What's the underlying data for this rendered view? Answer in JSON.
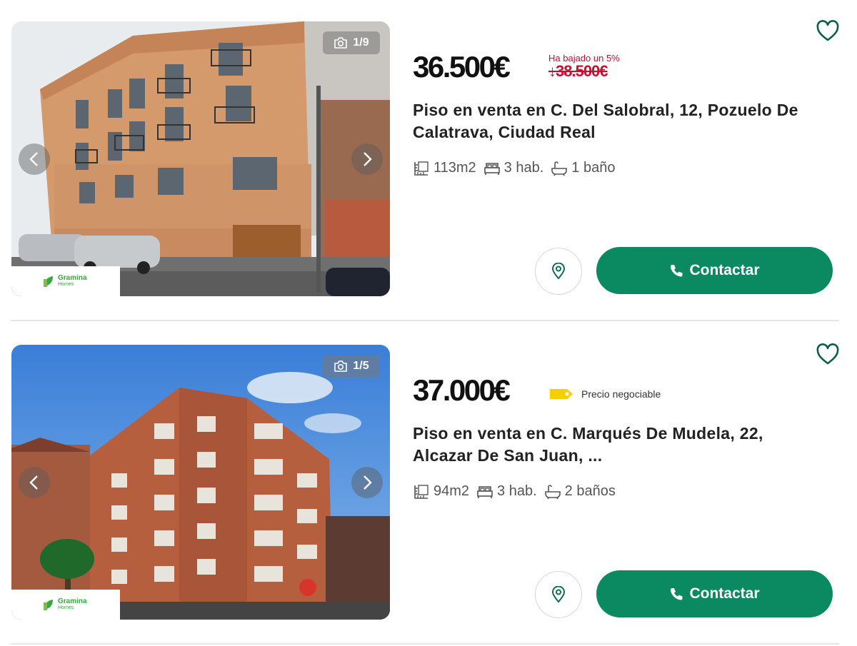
{
  "listings": [
    {
      "photo_counter": "1/9",
      "agency_logo": {
        "name": "Gramina",
        "sub": "Homes"
      },
      "price": "36.500€",
      "price_drop_note": "Ha bajado un 5%",
      "old_price": "↓38.500€",
      "title": "Piso en venta en C. Del Salobral, 12, Pozuelo De Calatrava, Ciudad Real",
      "features": {
        "area": "113m2",
        "rooms": "3 hab.",
        "baths": "1 baño"
      },
      "contact_label": "Contactar"
    },
    {
      "photo_counter": "1/5",
      "agency_logo": {
        "name": "Gramina",
        "sub": "Homes"
      },
      "price": "37.000€",
      "negotiable_label": "Precio negociable",
      "title": "Piso en venta en C. Marqués De Mudela, 22, Alcazar De San Juan, ...",
      "features": {
        "area": "94m2",
        "rooms": "3 hab.",
        "baths": "2 baños"
      },
      "contact_label": "Contactar"
    }
  ],
  "icons": {
    "camera": "camera-icon",
    "prev": "chevron-left-icon",
    "next": "chevron-right-icon",
    "favorite": "heart-outline-icon",
    "map": "map-pin-icon",
    "phone": "phone-icon",
    "area": "floor-plan-icon",
    "rooms": "bed-icon",
    "baths": "bathtub-icon",
    "tag": "price-tag-icon"
  },
  "colors": {
    "accent": "#0b8a62",
    "price_drop": "#c8102e",
    "tag": "#f4d000",
    "brand_logo": "#36a93a"
  }
}
